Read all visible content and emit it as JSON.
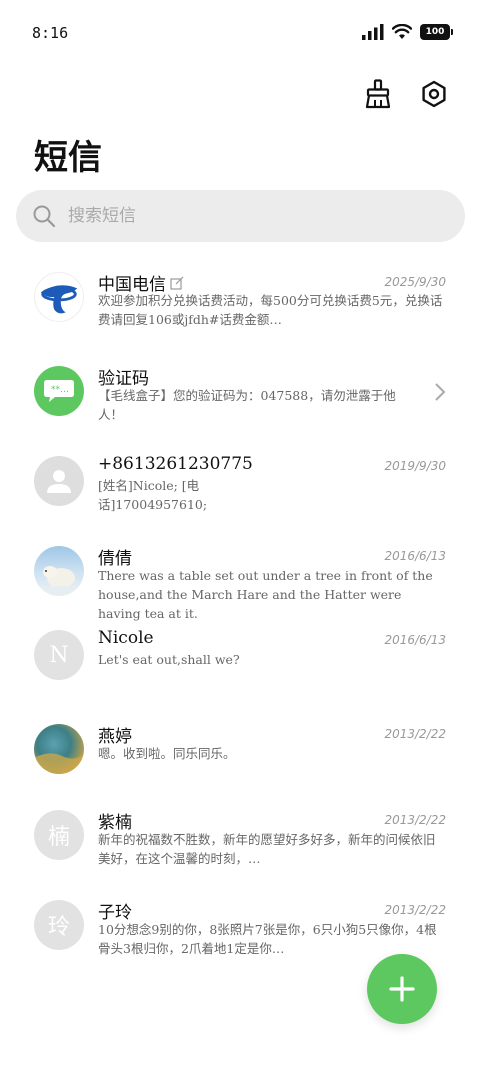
{
  "status_bar": {
    "time": "8:16",
    "battery": "100"
  },
  "page": {
    "title": "短信"
  },
  "search": {
    "placeholder": "搜索短信"
  },
  "colors": {
    "accent": "#5dc860",
    "telecom_blue": "#1e5bb8"
  },
  "conversations": [
    {
      "name": "中国电信",
      "date": "2025/9/30",
      "preview": "欢迎参加积分兑换话费活动，每500分可兑换话费5元，兑换话费请回复106或jfdh#话费金额…",
      "avatar": "telecom-logo"
    },
    {
      "name": "验证码",
      "date": "",
      "preview": "【毛线盒子】您的验证码为：047588，请勿泄露于他人！",
      "avatar": "chat-icon"
    },
    {
      "name": "+8613261230775",
      "date": "2019/9/30",
      "preview": "[姓名]Nicole; [电话]17004957610;",
      "avatar": "person-icon"
    },
    {
      "name": "倩倩",
      "date": "2016/6/13",
      "preview": "There was a table set out under a tree in front of the house,and the March Hare and the Hatter were having tea at it.",
      "avatar": "polar-bear-photo"
    },
    {
      "name": "Nicole",
      "date": "2016/6/13",
      "preview": "Let's eat out,shall we?",
      "avatar_letter": "N"
    },
    {
      "name": "燕婷",
      "date": "2013/2/22",
      "preview": "嗯。收到啦。同乐同乐。",
      "avatar": "landscape-photo"
    },
    {
      "name": "紫楠",
      "date": "2013/2/22",
      "preview": "新年的祝福数不胜数，新年的愿望好多好多，新年的问候依旧美好，在这个温馨的时刻，…",
      "avatar_letter": "楠"
    },
    {
      "name": "子玲",
      "date": "2013/2/22",
      "preview": "10分想念9别的你，8张照片7张是你，6只小狗5只像你，4根骨头3根归你，2爪着地1定是你…",
      "avatar_letter": "玲"
    }
  ]
}
